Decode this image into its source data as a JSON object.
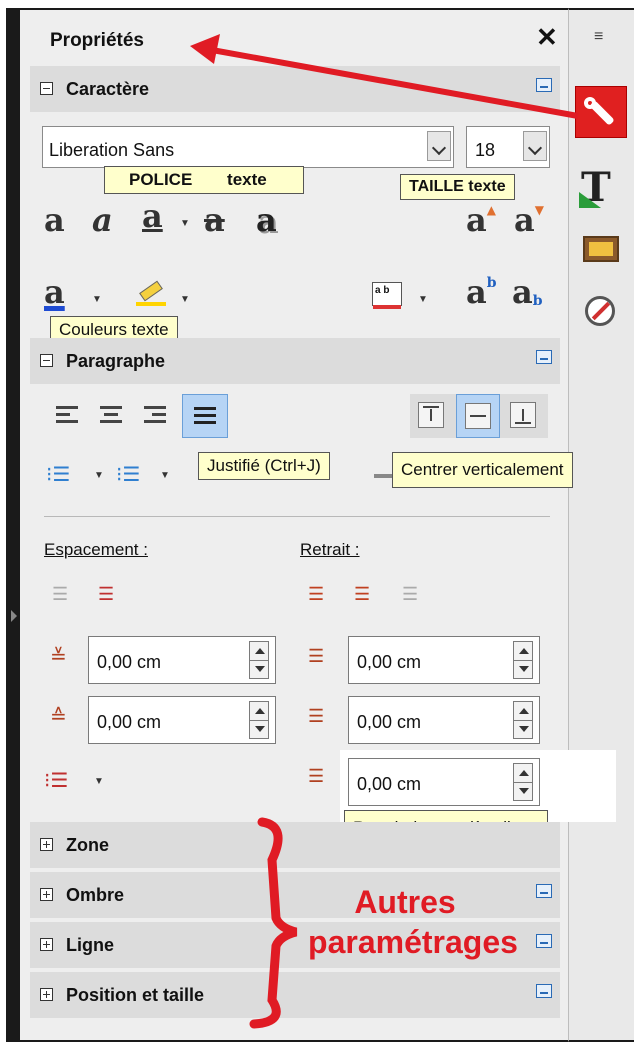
{
  "panel": {
    "title": "Propriétés",
    "close_glyph": "✕"
  },
  "sections": {
    "caractere": "Caractère",
    "paragraphe": "Paragraphe",
    "zone": "Zone",
    "ombre": "Ombre",
    "ligne": "Ligne",
    "position": "Position et taille"
  },
  "font": {
    "name": "Liberation Sans",
    "size": "18"
  },
  "tooltips": {
    "police": "POLICE",
    "police_texte": "texte",
    "taille": "TAILLE texte",
    "couleurs": "Couleurs texte",
    "justifie": "Justifié (Ctrl+J)",
    "centrer": "Centrer verticalement",
    "retrait_premiere": "Retrait de première ligne"
  },
  "spacing": {
    "espacement_label": "Espacement :",
    "retrait_label": "Retrait :",
    "above": "0,00 cm",
    "below": "0,00 cm",
    "indent_before": "0,00 cm",
    "indent_after": "0,00 cm",
    "first_line": "0,00 cm"
  },
  "annotation": {
    "line1": "Autres",
    "line2": "paramétrages"
  },
  "icons": {
    "style_buttons": [
      "bold-icon",
      "italic-icon",
      "underline-icon",
      "strikethrough-icon",
      "shadow-icon"
    ],
    "size_buttons": [
      "grow-font-icon",
      "shrink-font-icon"
    ],
    "align_buttons": [
      "align-left-icon",
      "align-center-icon",
      "align-right-icon",
      "justify-icon"
    ],
    "valign_buttons": [
      "align-top-icon",
      "center-vertically-icon",
      "align-bottom-icon"
    ],
    "sidebar_tabs": [
      "properties-icon",
      "styles-icon",
      "gallery-icon",
      "navigator-icon"
    ]
  },
  "colors": {
    "accent": "#e01b24",
    "selected_bg": "#b6d4f5",
    "tooltip_bg": "#ffffcc"
  }
}
